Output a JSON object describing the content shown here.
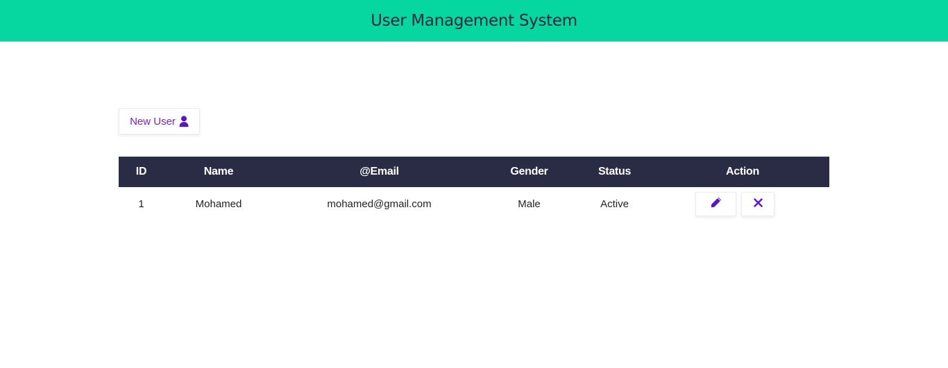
{
  "header": {
    "title": "User Management System"
  },
  "toolbar": {
    "new_user_label": "New User"
  },
  "table": {
    "columns": [
      "ID",
      "Name",
      "@Email",
      "Gender",
      "Status",
      "Action"
    ],
    "rows": [
      {
        "id": "1",
        "name": "Mohamed",
        "email": "mohamed@gmail.com",
        "gender": "Male",
        "status": "Active"
      }
    ]
  },
  "icons": {
    "new_user": "user-icon",
    "edit": "pencil-icon",
    "delete": "close-icon"
  },
  "colors": {
    "header_bg": "#06d6a0",
    "table_header_bg": "#2a2b45",
    "accent": "#7b1fd1"
  }
}
